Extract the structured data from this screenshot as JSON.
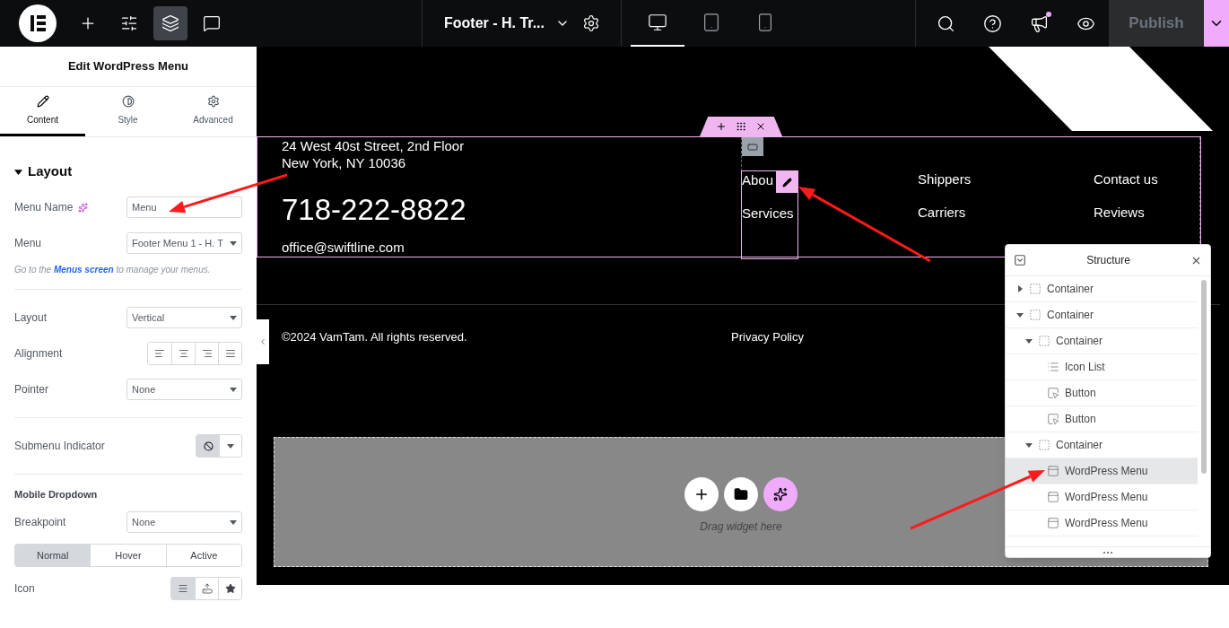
{
  "topbar": {
    "tools": [
      {
        "kind": "add",
        "selected": false
      },
      {
        "kind": "settings",
        "selected": false
      },
      {
        "kind": "structure",
        "selected": true
      },
      {
        "kind": "comments",
        "selected": false
      }
    ],
    "document_title": "Footer - H. Tr...",
    "devices": [
      {
        "kind": "desktop",
        "selected": true
      },
      {
        "kind": "tablet",
        "selected": false
      },
      {
        "kind": "mobile",
        "selected": false
      }
    ],
    "actions": [
      {
        "kind": "search",
        "notification": false
      },
      {
        "kind": "help",
        "notification": false
      },
      {
        "kind": "whats-new",
        "notification": true
      },
      {
        "kind": "preview",
        "notification": false
      }
    ],
    "publish": {
      "label": "Publish",
      "disabled": true
    }
  },
  "panel": {
    "title": "Edit WordPress Menu",
    "tabs": [
      {
        "label": "Content",
        "kind": "pencil",
        "selected": true
      },
      {
        "label": "Style",
        "kind": "contrast",
        "selected": false
      },
      {
        "label": "Advanced",
        "kind": "gear",
        "selected": false
      }
    ],
    "section": {
      "title": "Layout",
      "expanded": true
    },
    "controls": [
      {
        "kind": "text",
        "label": "Menu Name",
        "ai": true,
        "value": "Menu"
      },
      {
        "kind": "select",
        "label": "Menu",
        "value": "Footer Menu 1 - H. T"
      },
      {
        "kind": "hint",
        "text_before": "Go to the",
        "link": "Menus screen",
        "text_after": "to manage your menus."
      },
      {
        "kind": "divider"
      },
      {
        "kind": "select",
        "label": "Layout",
        "value": "Vertical"
      },
      {
        "kind": "choices",
        "label": "Alignment",
        "options": [
          {
            "kind": "align-left",
            "selected": false
          },
          {
            "kind": "align-center",
            "selected": false
          },
          {
            "kind": "align-right",
            "selected": false
          },
          {
            "kind": "justify",
            "selected": false
          }
        ]
      },
      {
        "kind": "select",
        "label": "Pointer",
        "value": "None"
      },
      {
        "kind": "divider"
      },
      {
        "kind": "icon-select",
        "label": "Submenu Indicator",
        "options": [
          {
            "kind": "none",
            "selected": true
          }
        ]
      },
      {
        "kind": "divider"
      },
      {
        "kind": "heading",
        "label": "Mobile Dropdown"
      },
      {
        "kind": "select",
        "label": "Breakpoint",
        "value": "None"
      },
      {
        "kind": "state-tabs",
        "tabs": [
          {
            "label": "Normal",
            "selected": true
          },
          {
            "label": "Hover",
            "selected": false
          },
          {
            "label": "Active",
            "selected": false
          }
        ]
      },
      {
        "kind": "choices",
        "label": "Icon",
        "options": [
          {
            "kind": "hamburger",
            "selected": true
          },
          {
            "kind": "upload",
            "selected": false
          },
          {
            "kind": "star",
            "selected": false
          }
        ]
      }
    ]
  },
  "canvas": {
    "address": [
      "24 West 40st Street, 2nd Floor",
      "New York, NY 10036"
    ],
    "phone": "718-222-8822",
    "email": "office@swiftline.com",
    "menus": [
      {
        "items": [
          "Abou",
          "Services"
        ],
        "selected": true
      },
      {
        "items": [
          "Shippers",
          "Carriers"
        ],
        "selected": false
      },
      {
        "items": [
          "Contact us",
          "Reviews"
        ],
        "selected": false
      }
    ],
    "copyright": "©2024 VamTam. All rights reserved.",
    "footer_link": "Privacy Policy",
    "drop_zone": {
      "hint": "Drag widget here"
    }
  },
  "structure": {
    "title": "Structure",
    "items": [
      {
        "label": "Container",
        "kind": "container",
        "expanded": false,
        "selected": false
      },
      {
        "label": "Container",
        "kind": "container",
        "expanded": true,
        "selected": false,
        "children": [
          {
            "label": "Container",
            "kind": "container",
            "expanded": true,
            "selected": false,
            "children": [
              {
                "label": "Icon List",
                "kind": "icon-list",
                "selected": false
              },
              {
                "label": "Button",
                "kind": "button",
                "selected": false
              },
              {
                "label": "Button",
                "kind": "button",
                "selected": false
              }
            ]
          },
          {
            "label": "Container",
            "kind": "container",
            "expanded": true,
            "selected": false,
            "children": [
              {
                "label": "WordPress Menu",
                "kind": "menu",
                "selected": true
              },
              {
                "label": "WordPress Menu",
                "kind": "menu",
                "selected": false
              },
              {
                "label": "WordPress Menu",
                "kind": "menu",
                "selected": false
              }
            ]
          }
        ]
      }
    ]
  }
}
